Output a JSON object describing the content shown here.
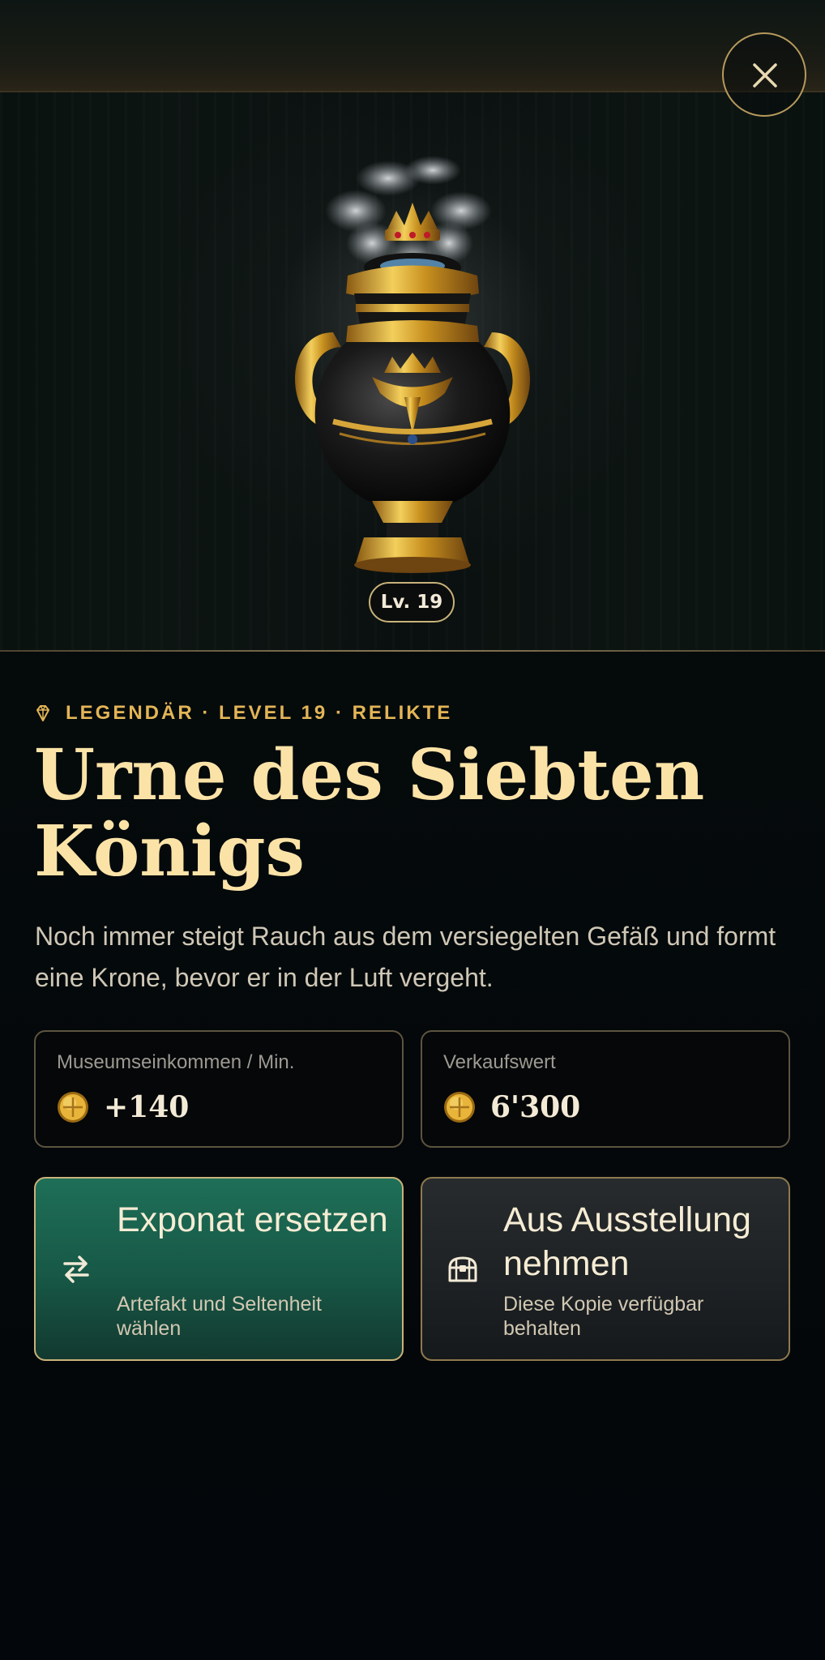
{
  "hero": {
    "close_icon": "close-icon",
    "artifact_image": "crowned-black-gold-urn-with-smoke",
    "level_badge": "Lv. 19"
  },
  "meta": {
    "icon": "gem-icon",
    "line": "LEGENDÄR · LEVEL 19 · RELIKTE"
  },
  "title": "Urne des Siebten Königs",
  "description": "Noch immer steigt Rauch aus dem versiegelten Gefäß und formt eine Krone, bevor er in der Luft vergeht.",
  "stats": [
    {
      "label": "Museumseinkommen / Min.",
      "icon": "gold-coin-icon",
      "value": "+140"
    },
    {
      "label": "Verkaufswert",
      "icon": "gold-coin-icon",
      "value": "6'300"
    }
  ],
  "actions": [
    {
      "icon": "swap-arrows-icon",
      "title": "Exponat ersetzen",
      "subtitle": "Artefakt und Seltenheit wählen"
    },
    {
      "icon": "treasure-chest-icon",
      "title": "Aus Ausstellung nehmen",
      "subtitle": "Diese Kopie verfügbar behalten"
    }
  ],
  "colors": {
    "accent_gold": "#e3b556",
    "title_gold": "#fbe3a7",
    "primary_green": "#1e6f58",
    "card_border": "#5d5440",
    "background": "#04070a"
  }
}
